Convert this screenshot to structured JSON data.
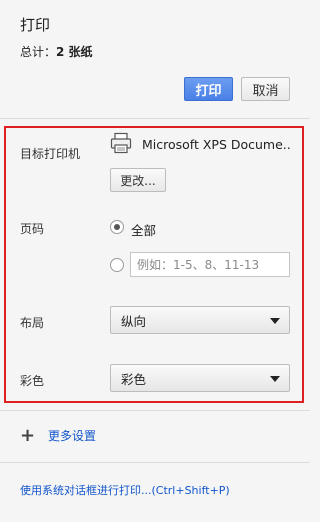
{
  "header": {
    "title": "打印",
    "summary_label": "总计：",
    "summary_value": "2 张纸"
  },
  "actions": {
    "print_label": "打印",
    "cancel_label": "取消"
  },
  "destination": {
    "label": "目标打印机",
    "printer_name": "Microsoft XPS Docume...",
    "change_label": "更改..."
  },
  "pages": {
    "label": "页码",
    "all_label": "全部",
    "all_selected": true,
    "custom_placeholder": "例如：1-5、8、11-13"
  },
  "layout": {
    "label": "布局",
    "selected": "纵向"
  },
  "color": {
    "label": "彩色",
    "selected": "彩色"
  },
  "more_settings": {
    "label": "更多设置",
    "icon": "plus-icon"
  },
  "system_dialog": {
    "label": "使用系统对话框进行打印...(Ctrl+Shift+P)"
  },
  "colors": {
    "primary_button": "#4a80e6",
    "link": "#1155cc",
    "highlight_border": "#e02020"
  }
}
